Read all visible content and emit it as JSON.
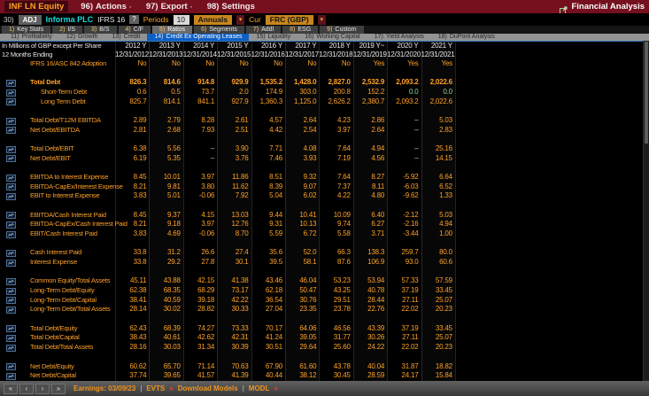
{
  "titlebar": {
    "security": "INF LN Equity",
    "menus": [
      {
        "num": "96)",
        "label": "Actions",
        "dropdown": true
      },
      {
        "num": "97)",
        "label": "Export",
        "dropdown": true
      },
      {
        "num": "98)",
        "label": "Settings",
        "dropdown": false
      }
    ],
    "app_title": "Financial Analysis"
  },
  "toolbar": {
    "adj_num": "30)",
    "adj_label": "ADJ",
    "company": "Informa PLC",
    "standard": "IFRS 16",
    "help": "?",
    "periods_label": "Periods",
    "periods_value": "10",
    "period_type": "Annuals",
    "currency_label": "Cur",
    "currency_value": "FRC (GBP)"
  },
  "tabs": {
    "selected_index": 4,
    "items": [
      {
        "num": "1)",
        "label": "Key Stats"
      },
      {
        "num": "2)",
        "label": "I/S"
      },
      {
        "num": "3)",
        "label": "B/S"
      },
      {
        "num": "4)",
        "label": "C/F"
      },
      {
        "num": "5)",
        "label": "Ratios"
      },
      {
        "num": "6)",
        "label": "Segments"
      },
      {
        "num": "7)",
        "label": "Addl"
      },
      {
        "num": "8)",
        "label": "ESG"
      },
      {
        "num": "9)",
        "label": "Custom"
      }
    ]
  },
  "subtabs": {
    "selected_index": 3,
    "items": [
      {
        "num": "11)",
        "label": "Profitability"
      },
      {
        "num": "12)",
        "label": "Growth"
      },
      {
        "num": "13)",
        "label": "Credit"
      },
      {
        "num": "14)",
        "label": "Credit Ex Operating Leases"
      },
      {
        "num": "15)",
        "label": "Liquidity"
      },
      {
        "num": "16)",
        "label": "Working Capital"
      },
      {
        "num": "17)",
        "label": "Yield Analysis"
      },
      {
        "num": "18)",
        "label": "DuPont Analysis"
      }
    ]
  },
  "table": {
    "unit_note": "In Millions of GBP except Per Share",
    "period_note": "12 Months Ending",
    "columns": [
      {
        "year": "2012 Y",
        "date": "12/31/2012"
      },
      {
        "year": "2013 Y",
        "date": "12/31/2013"
      },
      {
        "year": "2014 Y",
        "date": "12/31/2014"
      },
      {
        "year": "2015 Y",
        "date": "12/31/2015"
      },
      {
        "year": "2016 Y",
        "date": "12/31/2016"
      },
      {
        "year": "2017 Y",
        "date": "12/31/2017"
      },
      {
        "year": "2018 Y",
        "date": "12/31/2018"
      },
      {
        "year": "2019 Y~",
        "date": "12/31/2019"
      },
      {
        "year": "2020 Y",
        "date": "12/31/2020"
      },
      {
        "year": "2021 Y",
        "date": "12/31/2021"
      }
    ],
    "adoption_row": {
      "label": "IFRS 16/ASC 842 Adoption",
      "values": [
        "No",
        "No",
        "No",
        "No",
        "No",
        "No",
        "No",
        "Yes",
        "Yes",
        "Yes"
      ]
    },
    "groups": [
      {
        "rows": [
          {
            "label": "Total Debt",
            "emphasis": true,
            "values": [
              "826.3",
              "814.6",
              "914.8",
              "929.9",
              "1,535.2",
              "1,428.0",
              "2,827.0",
              "2,532.9",
              "2,093.2",
              "2,022.6"
            ]
          },
          {
            "label": "Short-Term Debt",
            "indent": 1,
            "values": [
              "0.6",
              "0.5",
              "73.7",
              "2.0",
              "174.9",
              "303.0",
              "200.8",
              "152.2",
              "0.0",
              "0.0"
            ]
          },
          {
            "label": "Long Term Debt",
            "indent": 1,
            "values": [
              "825.7",
              "814.1",
              "841.1",
              "927.9",
              "1,360.3",
              "1,125.0",
              "2,626.2",
              "2,380.7",
              "2,093.2",
              "2,022.6"
            ]
          }
        ]
      },
      {
        "rows": [
          {
            "label": "Total Debt/T12M EBITDA",
            "values": [
              "2.89",
              "2.79",
              "8.28",
              "2.61",
              "4.57",
              "2.64",
              "4.23",
              "2.86",
              "–",
              "5.03"
            ]
          },
          {
            "label": "Net Debt/EBITDA",
            "values": [
              "2.81",
              "2.68",
              "7.93",
              "2.51",
              "4.42",
              "2.54",
              "3.97",
              "2.64",
              "–",
              "2.83"
            ]
          }
        ]
      },
      {
        "rows": [
          {
            "label": "Total Debt/EBIT",
            "values": [
              "6.38",
              "5.56",
              "–",
              "3.90",
              "7.71",
              "4.08",
              "7.64",
              "4.94",
              "–",
              "25.16"
            ]
          },
          {
            "label": "Net Debt/EBIT",
            "values": [
              "6.19",
              "5.35",
              "–",
              "3.76",
              "7.46",
              "3.93",
              "7.19",
              "4.56",
              "–",
              "14.15"
            ]
          }
        ]
      },
      {
        "rows": [
          {
            "label": "EBITDA to Interest Expense",
            "values": [
              "8.45",
              "10.01",
              "3.97",
              "11.86",
              "8.51",
              "9.32",
              "7.64",
              "8.27",
              "-5.92",
              "6.64"
            ]
          },
          {
            "label": "EBITDA-CapEx/Interest Expense",
            "values": [
              "8.21",
              "9.81",
              "3.80",
              "11.62",
              "8.39",
              "9.07",
              "7.37",
              "8.11",
              "-6.03",
              "6.52"
            ]
          },
          {
            "label": "EBIT to Interest Expense",
            "values": [
              "3.83",
              "5.01",
              "-0.06",
              "7.92",
              "5.04",
              "6.02",
              "4.22",
              "4.80",
              "-9.62",
              "1.33"
            ]
          }
        ]
      },
      {
        "rows": [
          {
            "label": "EBITDA/Cash Interest Paid",
            "values": [
              "8.45",
              "9.37",
              "4.15",
              "13.03",
              "9.44",
              "10.41",
              "10.09",
              "6.40",
              "-2.12",
              "5.03"
            ]
          },
          {
            "label": "EBITDA-CapEx/Cash Interest Paid",
            "values": [
              "8.21",
              "9.18",
              "3.97",
              "12.76",
              "9.31",
              "10.13",
              "9.74",
              "6.27",
              "-2.16",
              "4.94"
            ]
          },
          {
            "label": "EBIT/Cash Interest Paid",
            "values": [
              "3.83",
              "4.69",
              "-0.06",
              "8.70",
              "5.59",
              "6.72",
              "5.58",
              "3.71",
              "-3.44",
              "1.00"
            ]
          }
        ]
      },
      {
        "rows": [
          {
            "label": "Cash Interest Paid",
            "values": [
              "33.8",
              "31.2",
              "26.6",
              "27.4",
              "35.6",
              "52.0",
              "66.3",
              "138.3",
              "259.7",
              "80.0"
            ]
          },
          {
            "label": "Interest Expense",
            "values": [
              "33.8",
              "29.2",
              "27.8",
              "30.1",
              "39.5",
              "58.1",
              "87.6",
              "106.9",
              "93.0",
              "60.6"
            ]
          }
        ]
      },
      {
        "rows": [
          {
            "label": "Common Equity/Total Assets",
            "values": [
              "45.11",
              "43.88",
              "42.15",
              "41.38",
              "43.46",
              "46.04",
              "53.23",
              "53.94",
              "57.33",
              "57.59"
            ]
          },
          {
            "label": "Long-Term Debt/Equity",
            "values": [
              "62.38",
              "68.35",
              "68.29",
              "73.17",
              "62.18",
              "50.47",
              "43.25",
              "40.78",
              "37.19",
              "33.45"
            ]
          },
          {
            "label": "Long-Term Debt/Capital",
            "values": [
              "38.41",
              "40.59",
              "39.18",
              "42.22",
              "36.54",
              "30.76",
              "29.51",
              "28.44",
              "27.11",
              "25.07"
            ]
          },
          {
            "label": "Long-Term Debt/Total Assets",
            "values": [
              "28.14",
              "30.02",
              "28.82",
              "30.33",
              "27.04",
              "23.35",
              "23.78",
              "22.76",
              "22.02",
              "20.23"
            ]
          }
        ]
      },
      {
        "rows": [
          {
            "label": "Total Debt/Equity",
            "values": [
              "62.43",
              "68.39",
              "74.27",
              "73.33",
              "70.17",
              "64.06",
              "46.56",
              "43.39",
              "37.19",
              "33.45"
            ]
          },
          {
            "label": "Total Debt/Capital",
            "values": [
              "38.43",
              "40.61",
              "42.62",
              "42.31",
              "41.24",
              "39.05",
              "31.77",
              "30.26",
              "27.11",
              "25.07"
            ]
          },
          {
            "label": "Total Debt/Total Assets",
            "values": [
              "28.16",
              "30.03",
              "31.34",
              "30.39",
              "30.51",
              "29.64",
              "25.60",
              "24.22",
              "22.02",
              "20.23"
            ]
          }
        ]
      },
      {
        "rows": [
          {
            "label": "Net Debt/Equity",
            "values": [
              "60.62",
              "65.70",
              "71.14",
              "70.63",
              "67.90",
              "61.60",
              "43.78",
              "40.04",
              "31.87",
              "18.82"
            ]
          },
          {
            "label": "Net Debt/Capital",
            "values": [
              "37.74",
              "39.65",
              "41.57",
              "41.39",
              "40.44",
              "38.12",
              "30.45",
              "28.59",
              "24.17",
              "15.84"
            ]
          }
        ]
      }
    ]
  },
  "footer": {
    "nav_buttons": [
      "«",
      "‹",
      "›",
      "»"
    ],
    "segments": [
      {
        "text": "Earnings: 03/09/23",
        "type": "label"
      },
      {
        "text": "|",
        "type": "sep"
      },
      {
        "text": "EVTS",
        "type": "link"
      },
      {
        "text": "»",
        "type": "arrow"
      },
      {
        "text": "Download Models",
        "type": "link"
      },
      {
        "text": "|",
        "type": "sep"
      },
      {
        "text": "MODL",
        "type": "link"
      },
      {
        "text": "»",
        "type": "arrow"
      }
    ]
  },
  "colors": {
    "titlebar_red": "#75101f",
    "value_amber": "#ffa126",
    "company_cyan": "#16dbdb",
    "selected_subtab_blue": "#0e5fc4",
    "dropdown_amber": "#c8861c",
    "zero_green": "#8fd48f",
    "panel_border_blue": "#3877b8"
  }
}
